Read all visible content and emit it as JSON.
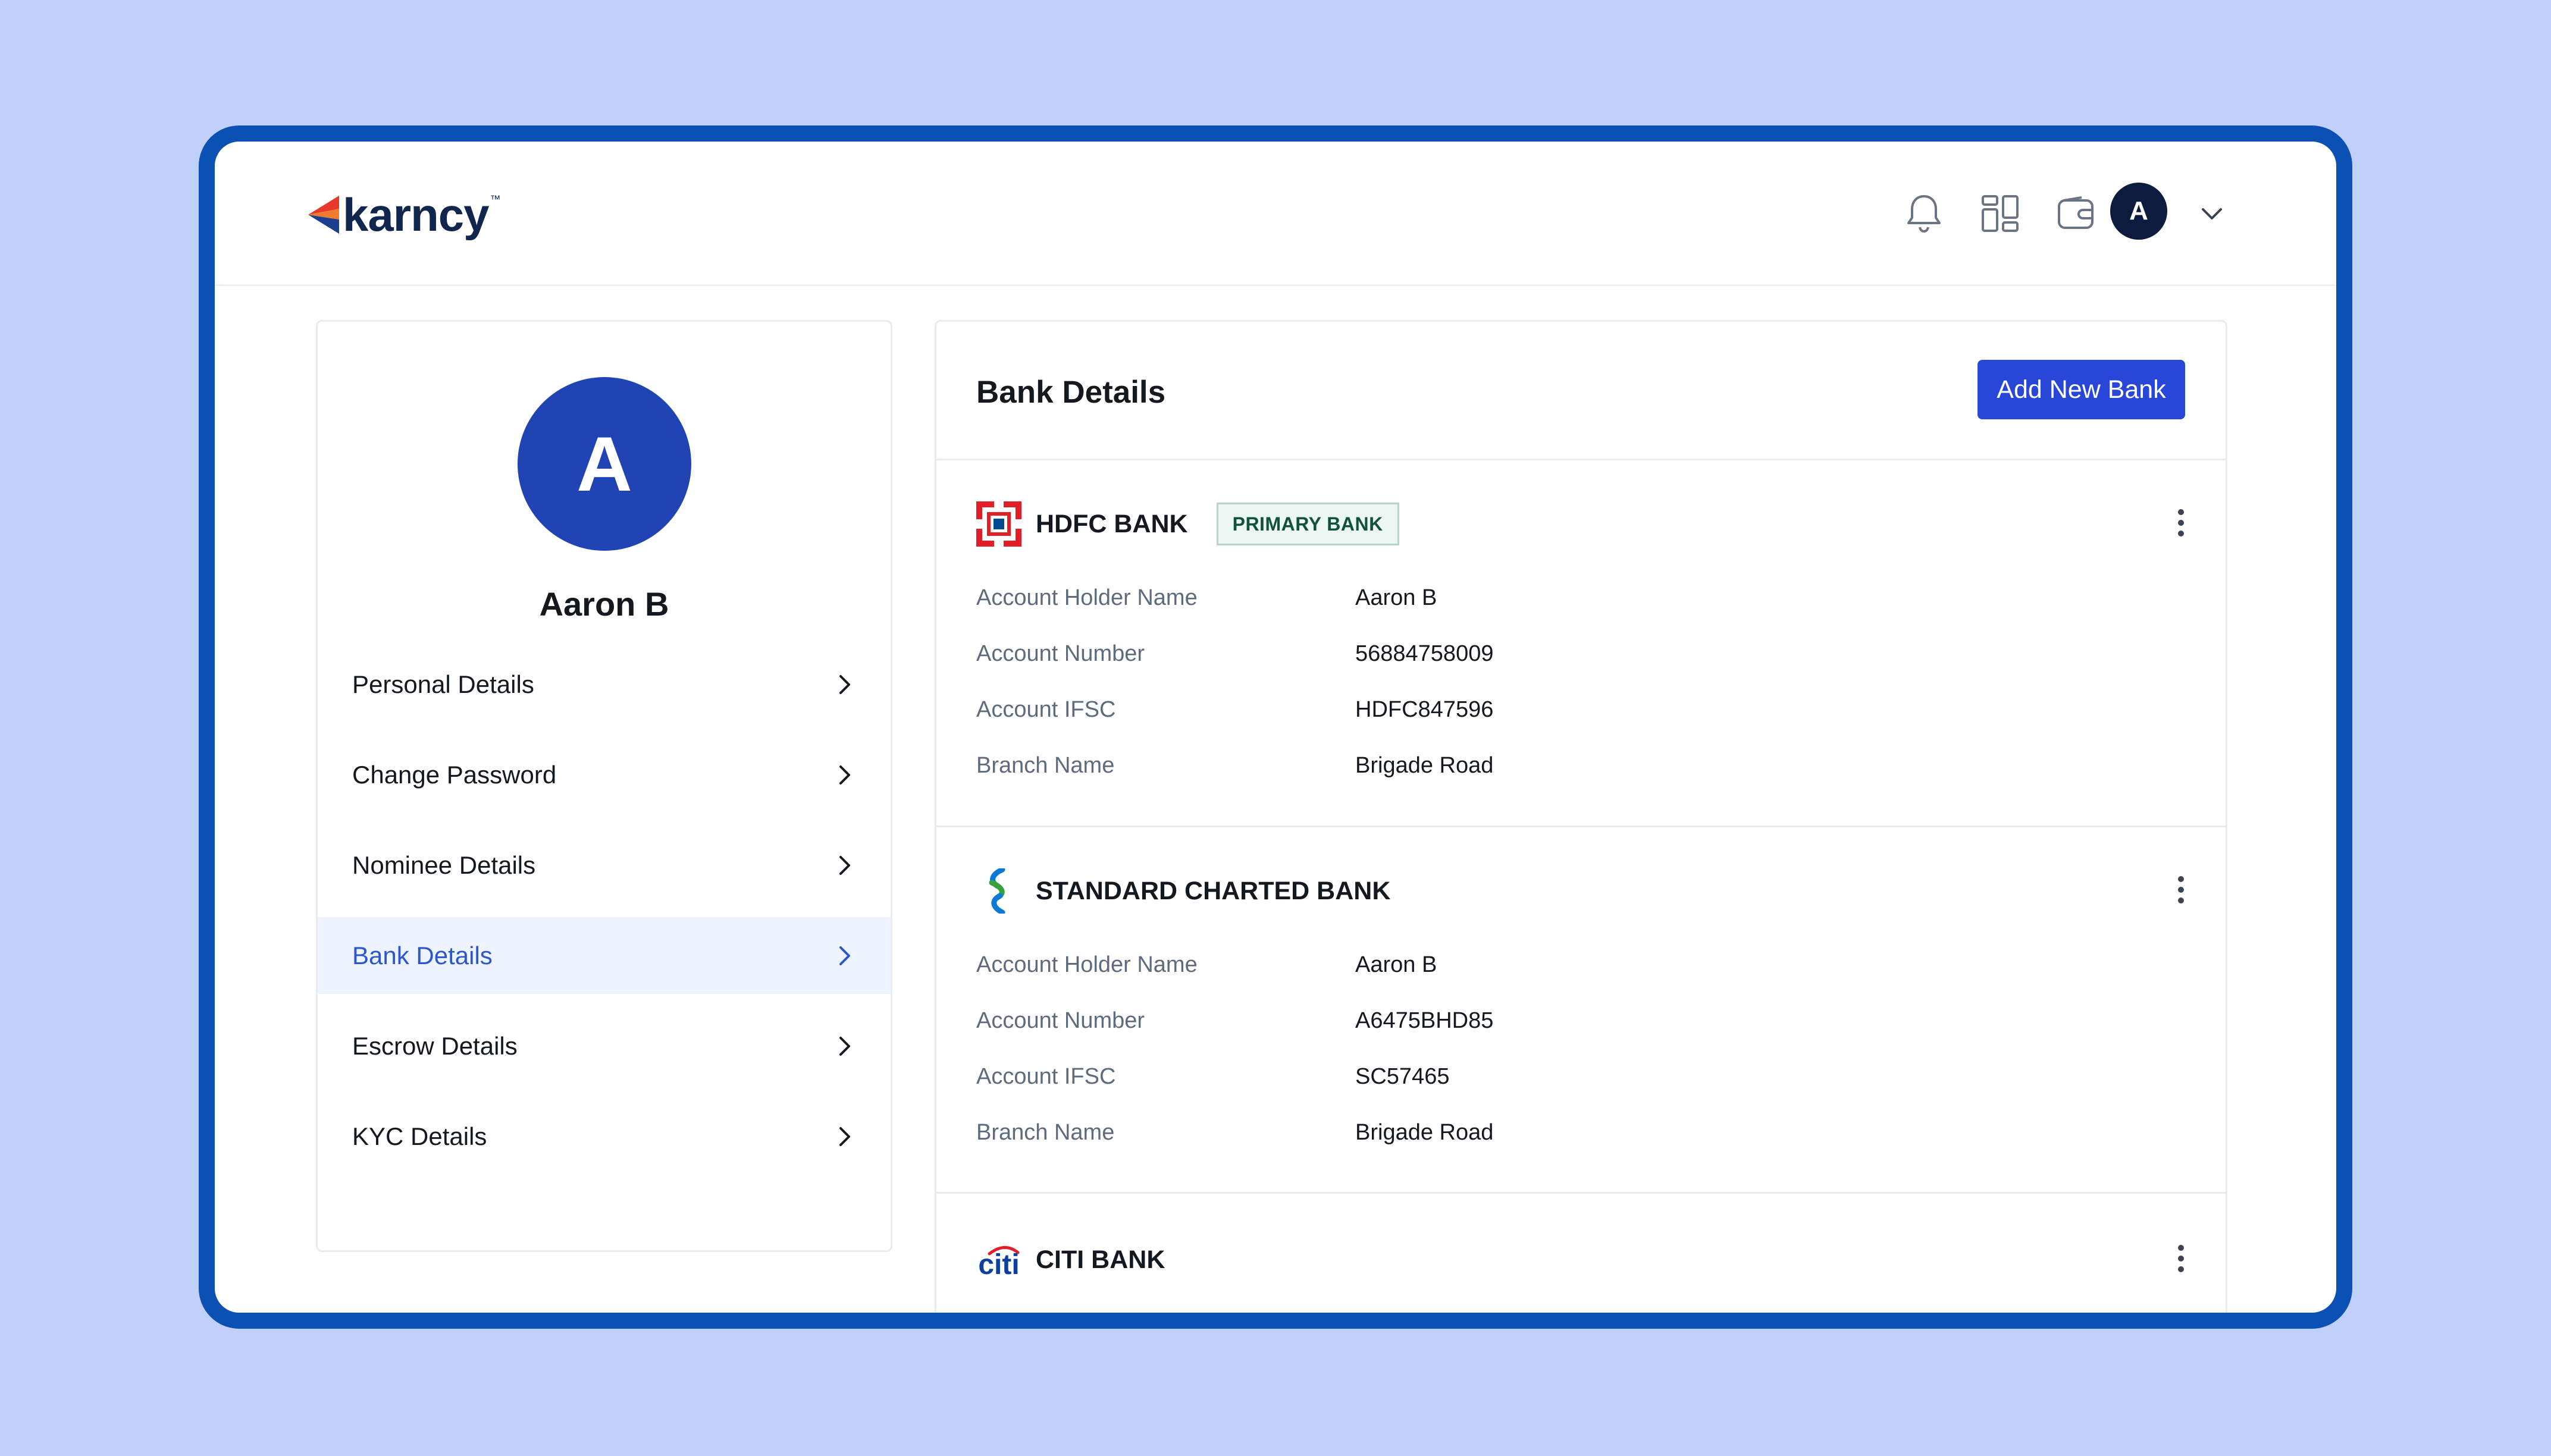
{
  "app": {
    "brand": "karncy",
    "brand_tm": "™",
    "colors": {
      "accent": "#2846d8",
      "frame": "#0b51b4",
      "background": "#c0d0fb",
      "logo_red": "#e8382a"
    }
  },
  "header": {
    "icons": [
      "bell-icon",
      "grid-icon",
      "wallet-icon"
    ],
    "avatar_initial": "A"
  },
  "profile": {
    "initial": "A",
    "name": "Aaron B",
    "menu": [
      {
        "label": "Personal Details",
        "active": false
      },
      {
        "label": "Change Password",
        "active": false
      },
      {
        "label": "Nominee Details",
        "active": false
      },
      {
        "label": "Bank Details",
        "active": true
      },
      {
        "label": "Escrow Details",
        "active": false
      },
      {
        "label": "KYC Details",
        "active": false
      }
    ]
  },
  "bank_details": {
    "title": "Bank Details",
    "add_button": "Add New Bank",
    "banks": [
      {
        "name": "HDFC BANK",
        "badge": "PRIMARY BANK",
        "fields": [
          {
            "label": "Account Holder Name",
            "value": "Aaron B"
          },
          {
            "label": "Account Number",
            "value": "56884758009"
          },
          {
            "label": "Account IFSC",
            "value": "HDFC847596"
          },
          {
            "label": "Branch Name",
            "value": "Brigade Road"
          }
        ]
      },
      {
        "name": "STANDARD CHARTED BANK",
        "fields": [
          {
            "label": "Account Holder Name",
            "value": "Aaron B"
          },
          {
            "label": "Account Number",
            "value": "A6475BHD85"
          },
          {
            "label": "Account IFSC",
            "value": "SC57465"
          },
          {
            "label": "Branch Name",
            "value": "Brigade Road"
          }
        ]
      },
      {
        "name": "CITI BANK",
        "logo_text": "citi",
        "fields": []
      }
    ]
  }
}
